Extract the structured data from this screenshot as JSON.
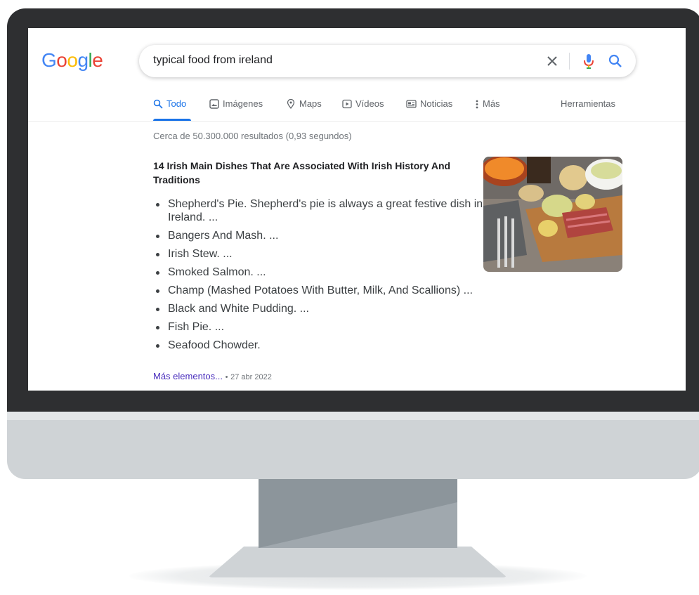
{
  "logo": {
    "letters": [
      "G",
      "o",
      "o",
      "g",
      "l",
      "e"
    ]
  },
  "search": {
    "query": "typical food from ireland"
  },
  "tabs": [
    {
      "label": "Todo",
      "icon": "search-icon"
    },
    {
      "label": "Imágenes",
      "icon": "image-icon"
    },
    {
      "label": "Maps",
      "icon": "map-pin-icon"
    },
    {
      "label": "Vídeos",
      "icon": "video-icon"
    },
    {
      "label": "Noticias",
      "icon": "news-icon"
    },
    {
      "label": "Más",
      "icon": "more-vert-icon"
    }
  ],
  "tools_label": "Herramientas",
  "result_stats": "Cerca de 50.300.000 resultados (0,93 segundos)",
  "result": {
    "title": "14 Irish Main Dishes That Are Associated With Irish History And Traditions",
    "items": [
      "Shepherd's Pie. Shepherd's pie is always a great festive dish in Ireland. ...",
      "Bangers And Mash. ...",
      "Irish Stew. ...",
      "Smoked Salmon. ...",
      "Champ (Mashed Potatoes With Butter, Milk, And Scallions) ...",
      "Black and White Pudding. ...",
      "Fish Pie. ...",
      "Seafood Chowder."
    ],
    "more_link": "Más elementos...",
    "separator": "•",
    "date": "27 abr 2022"
  },
  "colors": {
    "google_blue": "#4285f4",
    "google_red": "#ea4335",
    "google_yellow": "#fbbc05",
    "google_green": "#34a853",
    "active_tab": "#1a73e8",
    "visited_link": "#4a2fbd",
    "bezel": "#2e2f31"
  }
}
